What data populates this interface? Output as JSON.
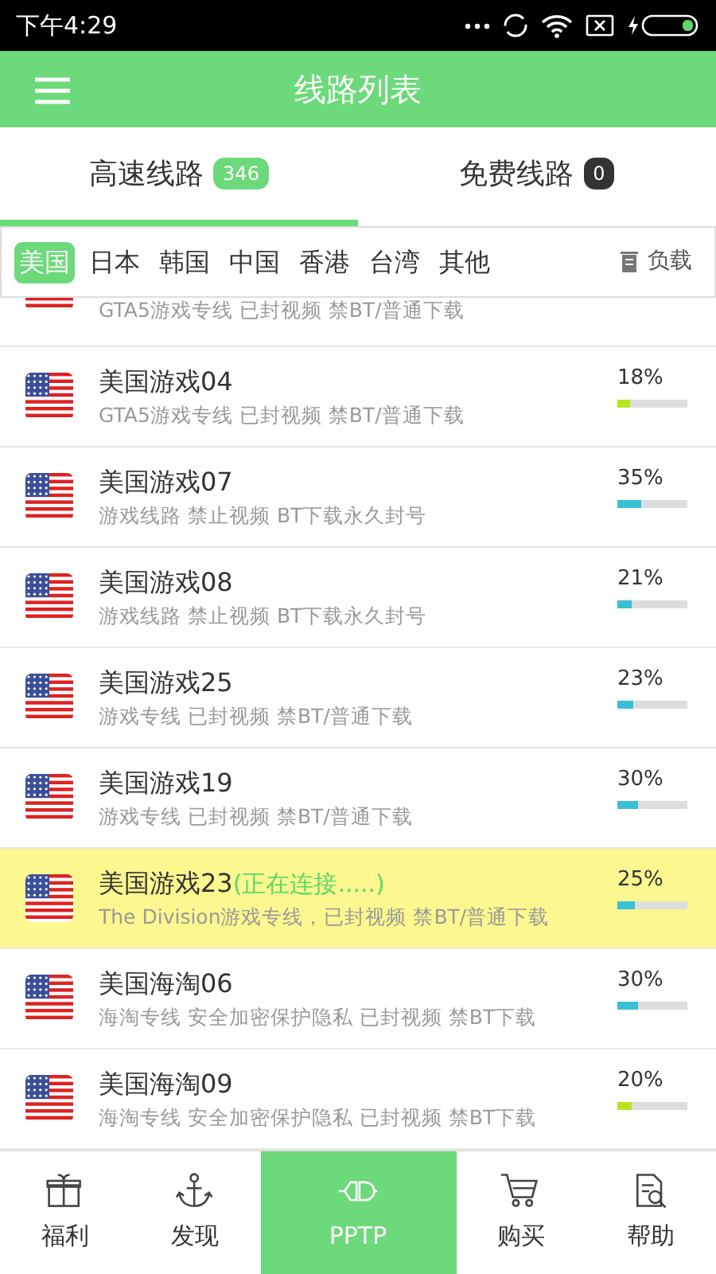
{
  "status_bar": {
    "time": "下午4:29"
  },
  "header": {
    "title": "线路列表"
  },
  "tabs": [
    {
      "label": "高速线路",
      "count": "346",
      "selected": true
    },
    {
      "label": "免费线路",
      "count": "0",
      "selected": false
    }
  ],
  "regions": [
    {
      "label": "美国",
      "selected": true
    },
    {
      "label": "日本",
      "selected": false
    },
    {
      "label": "韩国",
      "selected": false
    },
    {
      "label": "中国",
      "selected": false
    },
    {
      "label": "香港",
      "selected": false
    },
    {
      "label": "台湾",
      "selected": false
    },
    {
      "label": "其他",
      "selected": false
    }
  ],
  "sort": {
    "label": "负载"
  },
  "partial_row": {
    "subtitle": "GTA5游戏专线 已封视频 禁BT/普通下载"
  },
  "servers": [
    {
      "name": "美国游戏04",
      "subtitle": "GTA5游戏专线 已封视频 禁BT/普通下载",
      "load": "18%",
      "level": 0.18,
      "color": "#b5e61d",
      "selected": false
    },
    {
      "name": "美国游戏07",
      "subtitle": "游戏线路 禁止视频 BT下载永久封号",
      "load": "35%",
      "level": 0.35,
      "color": "#3bbfd6",
      "selected": false
    },
    {
      "name": "美国游戏08",
      "subtitle": "游戏线路 禁止视频 BT下载永久封号",
      "load": "21%",
      "level": 0.21,
      "color": "#3bbfd6",
      "selected": false
    },
    {
      "name": "美国游戏25",
      "subtitle": "游戏专线 已封视频 禁BT/普通下载",
      "load": "23%",
      "level": 0.23,
      "color": "#3bbfd6",
      "selected": false
    },
    {
      "name": "美国游戏19",
      "subtitle": "游戏专线 已封视频 禁BT/普通下载",
      "load": "30%",
      "level": 0.3,
      "color": "#3bbfd6",
      "selected": false
    },
    {
      "name": "美国游戏23",
      "status": "(正在连接.....)",
      "subtitle": "The Division游戏专线，已封视频 禁BT/普通下载",
      "load": "25%",
      "level": 0.25,
      "color": "#3bbfd6",
      "selected": true
    },
    {
      "name": "美国海淘06",
      "subtitle": "海淘专线 安全加密保护隐私 已封视频 禁BT下载",
      "load": "30%",
      "level": 0.3,
      "color": "#3bbfd6",
      "selected": false
    },
    {
      "name": "美国海淘09",
      "subtitle": "海淘专线 安全加密保护隐私 已封视频 禁BT下载",
      "load": "20%",
      "level": 0.2,
      "color": "#b5e61d",
      "selected": false
    }
  ],
  "bottom_nav": [
    {
      "label": "福利",
      "selected": false
    },
    {
      "label": "发现",
      "selected": false
    },
    {
      "label": "PPTP",
      "selected": true
    },
    {
      "label": "购买",
      "selected": false
    },
    {
      "label": "帮助",
      "selected": false
    }
  ]
}
